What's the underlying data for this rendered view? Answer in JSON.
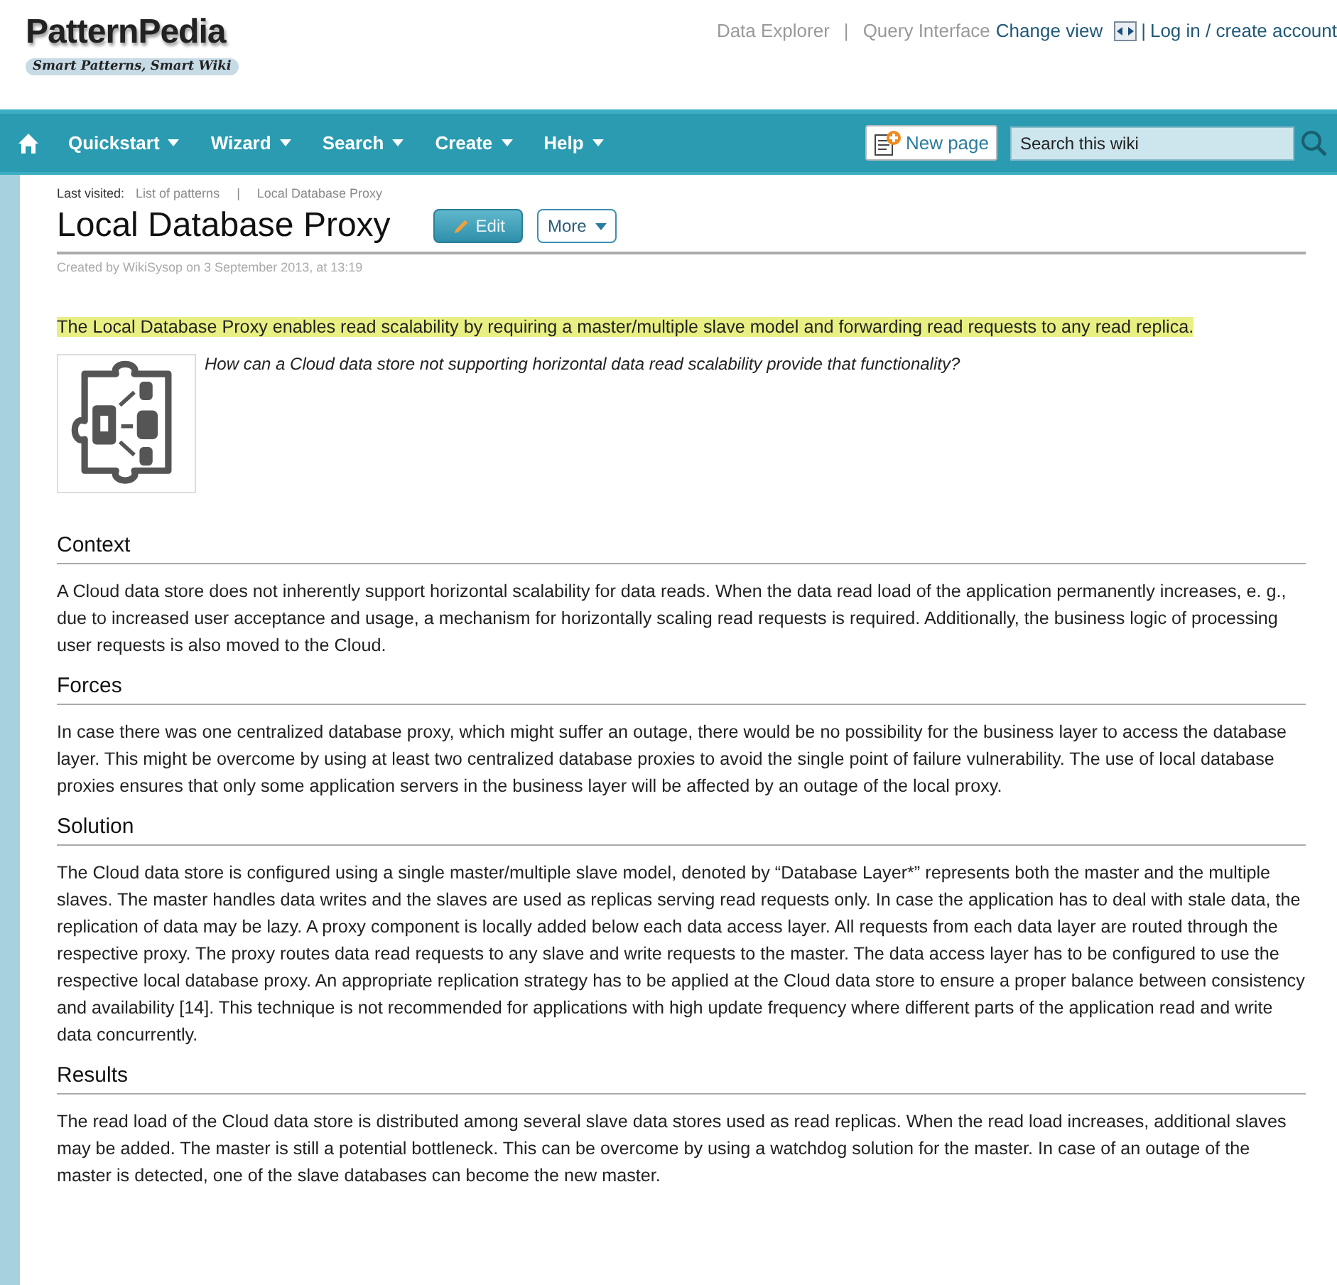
{
  "header": {
    "logo": "PatternPedia",
    "tagline": "Smart Patterns, Smart Wiki",
    "top_links": [
      {
        "kind": "link",
        "text": "Data Explorer",
        "muted": true
      },
      {
        "kind": "separator",
        "text": "|"
      },
      {
        "kind": "link",
        "text": "Query Interface",
        "muted": true
      },
      {
        "kind": "view",
        "text": "Change view",
        "muted": false
      },
      {
        "kind": "separator",
        "text": "|"
      },
      {
        "kind": "link",
        "text": "Log in / create account",
        "muted": false
      }
    ]
  },
  "navbar": {
    "menus": [
      "Quickstart",
      "Wizard",
      "Search",
      "Create",
      "Help"
    ],
    "new_page": "New page",
    "search": {
      "placeholder": "Search this wiki"
    }
  },
  "breadcrumb": {
    "label": "Last visited:",
    "items": [
      {
        "kind": "link",
        "text": "List of patterns"
      },
      {
        "kind": "separator",
        "text": "|"
      },
      {
        "kind": "link",
        "text": "Local Database Proxy"
      }
    ]
  },
  "page": {
    "title": "Local Database Proxy",
    "buttons": [
      {
        "kind": "edit",
        "label": "Edit"
      },
      {
        "kind": "more",
        "label": "More"
      }
    ],
    "meta": "Created by WikiSysop on 3 September 2013, at 13:19",
    "summary": "The Local Database Proxy enables read scalability by requiring a master/multiple slave model and forwarding read requests to any read replica.",
    "question": "How can a Cloud data store not supporting horizontal data read scalability provide that functionality?",
    "sections": [
      {
        "heading": "Context",
        "text": "A Cloud data store does not inherently support horizontal scalability for data reads. When the data read load of the application permanently increases, e. g., due to increased user acceptance and usage, a mechanism for horizontally scaling read requests is required. Additionally, the business logic of processing user requests is also moved to the Cloud."
      },
      {
        "heading": "Forces",
        "text": "In case there was one centralized database proxy, which might suffer an outage, there would be no possibility for the business layer to access the database layer. This might be overcome by using at least two centralized database proxies to avoid the single point of failure vulnerability. The use of local database proxies ensures that only some application servers in the business layer will be affected by an outage of the local proxy."
      },
      {
        "heading": "Solution",
        "text": "The Cloud data store is configured using a single master/multiple slave model, denoted by “Database Layer*” represents both the master and the multiple slaves. The master handles data writes and the slaves are used as replicas serving read requests only. In case the application has to deal with stale data, the replication of data may be lazy. A proxy component is locally added below each data access layer. All requests from each data layer are routed through the respective proxy. The proxy routes data read requests to any slave and write requests to the master. The data access layer has to be configured to use the respective local database proxy. An appropriate replication strategy has to be applied at the Cloud data store to ensure a proper balance between consistency and availability [14]. This technique is not recommended for applications with high update frequency where different parts of the application read and write data concurrently."
      },
      {
        "heading": "Results",
        "text": "The read load of the Cloud data store is distributed among several slave data stores used as read replicas. When the read load increases, additional slaves may be added. The master is still a potential bottleneck. This can be overcome by using a watchdog solution for the master. In case of an outage of the master is detected, one of the slave databases can become the new master."
      }
    ]
  }
}
